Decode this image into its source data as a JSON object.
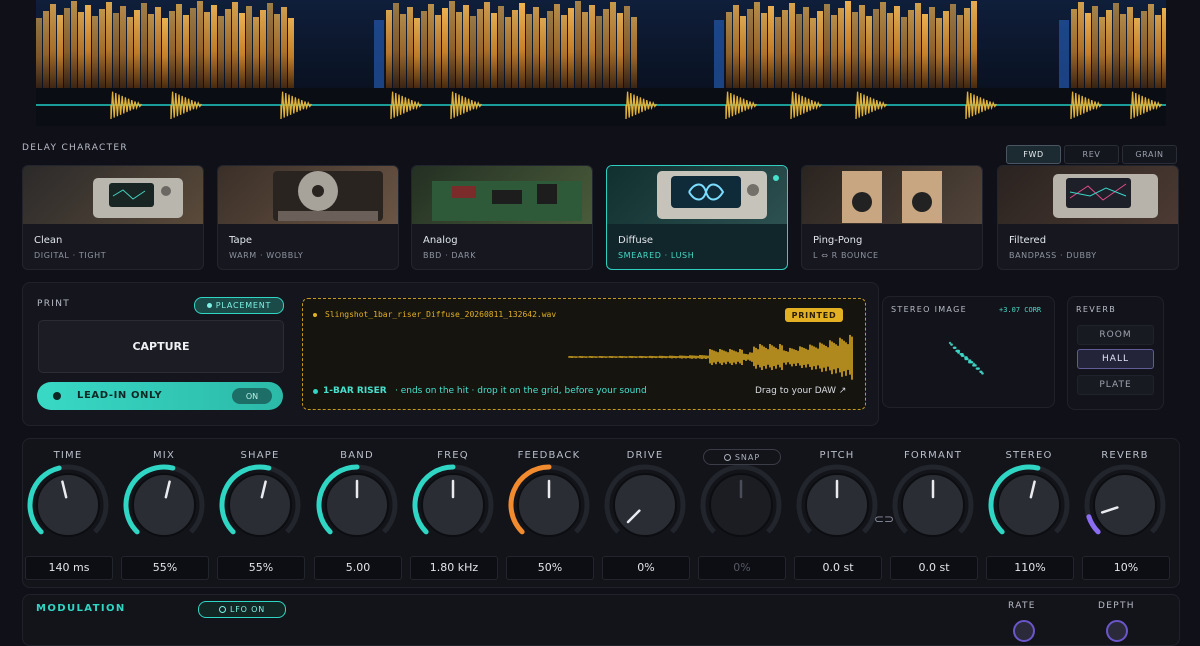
{
  "delay_character": {
    "title": "DELAY CHARACTER",
    "modes": [
      {
        "label": "FWD",
        "active": true
      },
      {
        "label": "REV",
        "active": false
      },
      {
        "label": "GRAIN",
        "active": false
      }
    ],
    "cards": [
      {
        "name": "Clean",
        "sub": "DIGITAL · TIGHT",
        "thumb": "rack-unit-icon",
        "selected": false
      },
      {
        "name": "Tape",
        "sub": "WARM · WOBBLY",
        "thumb": "tape-reel-icon",
        "selected": false
      },
      {
        "name": "Analog",
        "sub": "BBD · DARK",
        "thumb": "circuit-board-icon",
        "selected": false
      },
      {
        "name": "Diffuse",
        "sub": "SMEARED · LUSH",
        "thumb": "infinity-screen-icon",
        "selected": true
      },
      {
        "name": "Ping-Pong",
        "sub": "L ⇔ R BOUNCE",
        "thumb": "speakers-icon",
        "selected": false
      },
      {
        "name": "Filtered",
        "sub": "BANDPASS · DUBBY",
        "thumb": "filter-curve-icon",
        "selected": false
      }
    ]
  },
  "print": {
    "title": "PRINT",
    "badge": "PLACEMENT",
    "capture_label": "CAPTURE",
    "leadin_label": "LEAD-IN ONLY",
    "leadin_state": "ON",
    "file_name": "Slingshot_1bar_riser_Diffuse_20260811_132642.wav",
    "printed_badge": "PRINTED",
    "hint_bold": "1-BAR RISER",
    "hint_rest": "· ends on the hit · drop it on the grid, before your sound",
    "drag_label": "Drag to your DAW ↗"
  },
  "stereo_image": {
    "title": "STEREO IMAGE",
    "value": "+3.07 CORR"
  },
  "reverb": {
    "title": "REVERB",
    "options": [
      {
        "label": "ROOM",
        "active": false
      },
      {
        "label": "HALL",
        "active": true
      },
      {
        "label": "PLATE",
        "active": false
      }
    ]
  },
  "knobs": [
    {
      "label": "TIME",
      "value": "140 ms",
      "level": 0.45,
      "arc": "#2fd6c4",
      "enabled": true
    },
    {
      "label": "MIX",
      "value": "55%",
      "level": 0.55,
      "arc": "#2fd6c4",
      "enabled": true
    },
    {
      "label": "SHAPE",
      "value": "55%",
      "level": 0.55,
      "arc": "#2fd6c4",
      "enabled": true
    },
    {
      "label": "BAND",
      "value": "5.00",
      "level": 0.5,
      "arc": "#2fd6c4",
      "enabled": true
    },
    {
      "label": "FREQ",
      "value": "1.80 kHz",
      "level": 0.5,
      "arc": "#2fd6c4",
      "enabled": true
    },
    {
      "label": "FEEDBACK",
      "value": "50%",
      "level": 0.5,
      "arc": "#f28a2e",
      "enabled": true
    },
    {
      "label": "DRIVE",
      "value": "0%",
      "level": 0.0,
      "arc": "#2fd6c4",
      "enabled": true
    },
    {
      "label": "SNAP",
      "value": "0%",
      "level": 0.5,
      "arc": "#2fd6c4",
      "enabled": false
    },
    {
      "label": "PITCH",
      "value": "0.0 st",
      "level": 0.5,
      "arc": "#2fd6c4",
      "enabled": true,
      "show_arc": false
    },
    {
      "label": "FORMANT",
      "value": "0.0 st",
      "level": 0.5,
      "arc": "#2fd6c4",
      "enabled": true,
      "show_arc": false
    },
    {
      "label": "STEREO",
      "value": "110%",
      "level": 0.55,
      "arc": "#2fd6c4",
      "enabled": true
    },
    {
      "label": "REVERB",
      "value": "10%",
      "level": 0.1,
      "arc": "#8a6df0",
      "enabled": true
    }
  ],
  "modulation": {
    "title": "MODULATION",
    "lfo_label": "LFO ON",
    "rate_label": "RATE",
    "depth_label": "DEPTH"
  },
  "colors": {
    "accent": "#2fd6c4",
    "warm": "#e3b024",
    "feedback": "#f28a2e",
    "reverb": "#8a6df0"
  }
}
